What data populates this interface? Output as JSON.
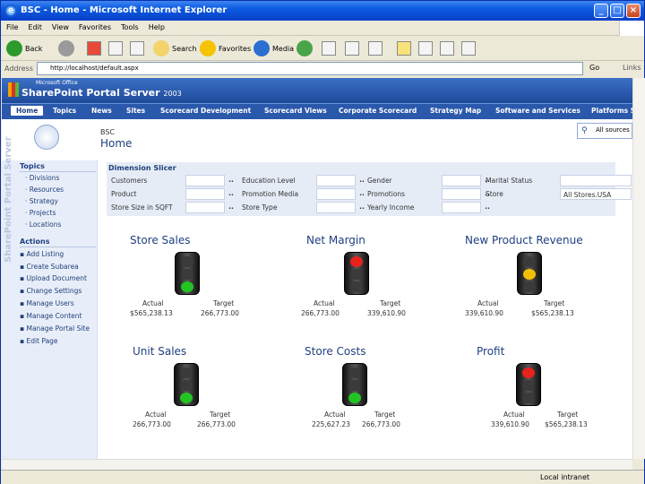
{
  "window": {
    "title": "BSC - Home - Microsoft Internet Explorer"
  },
  "menu": [
    "File",
    "Edit",
    "View",
    "Favorites",
    "Tools",
    "Help"
  ],
  "toolbar": {
    "back": "Back",
    "search": "Search",
    "favorites": "Favorites",
    "media": "Media"
  },
  "address": {
    "label": "Address",
    "url": "http://localhost/default.aspx",
    "go": "Go",
    "links": "Links"
  },
  "status": {
    "zone": "Local intranet"
  },
  "portal": {
    "vendor": "Microsoft Office",
    "product": "SharePoint Portal Server",
    "year": "2003",
    "watermark": "SharePoint Portal Server"
  },
  "nav": [
    "Home",
    "Topics",
    "News",
    "Sites",
    "Scorecard Development",
    "Scorecard Views",
    "Corporate Scorecard",
    "Strategy Map",
    "Software and Services",
    "Platforms S"
  ],
  "header": {
    "subtitle": "BSC",
    "title": "Home",
    "search_scope": "All sources"
  },
  "sidebar": {
    "topics_title": "Topics",
    "topics": [
      "Divisions",
      "Resources",
      "Strategy",
      "Projects",
      "Locations"
    ],
    "actions_title": "Actions",
    "actions": [
      "Add Listing",
      "Create Subarea",
      "Upload Document",
      "Change Settings",
      "Manage Users",
      "Manage Content",
      "Manage Portal Site",
      "Edit Page"
    ]
  },
  "slicer": {
    "title": "Dimension Slicer",
    "rows": [
      [
        {
          "label": "Customers",
          "value": ""
        },
        {
          "label": "Education Level",
          "value": ""
        },
        {
          "label": "Gender",
          "value": ""
        },
        {
          "label": "Marital Status",
          "value": ""
        }
      ],
      [
        {
          "label": "Product",
          "value": ""
        },
        {
          "label": "Promotion Media",
          "value": ""
        },
        {
          "label": "Promotions",
          "value": ""
        },
        {
          "label": "Store",
          "value": "All Stores.USA"
        }
      ],
      [
        {
          "label": "Store Size in SQFT",
          "value": ""
        },
        {
          "label": "Store Type",
          "value": ""
        },
        {
          "label": "Yearly Income",
          "value": ""
        }
      ]
    ]
  },
  "kpis": [
    {
      "title": "Store Sales",
      "status": "green",
      "actual_label": "Actual",
      "target_label": "Target",
      "actual": "$565,238.13",
      "target": "266,773.00"
    },
    {
      "title": "Net Margin",
      "status": "red",
      "actual_label": "Actual",
      "target_label": "Target",
      "actual": "266,773.00",
      "target": "339,610.90"
    },
    {
      "title": "New Product Revenue",
      "status": "yellow",
      "actual_label": "Actual",
      "target_label": "Target",
      "actual": "339,610.90",
      "target": "$565,238.13"
    },
    {
      "title": "Unit Sales",
      "status": "green",
      "actual_label": "Actual",
      "target_label": "Target",
      "actual": "266,773.00",
      "target": "266,773.00"
    },
    {
      "title": "Store Costs",
      "status": "green",
      "actual_label": "Actual",
      "target_label": "Target",
      "actual": "225,627.23",
      "target": "266,773.00"
    },
    {
      "title": "Profit",
      "status": "red",
      "actual_label": "Actual",
      "target_label": "Target",
      "actual": "339,610.90",
      "target": "$565,238.13"
    }
  ],
  "colors": {
    "green": "#22c422",
    "red": "#e8221c",
    "yellow": "#f0c000",
    "off": "#3a3a3a"
  }
}
